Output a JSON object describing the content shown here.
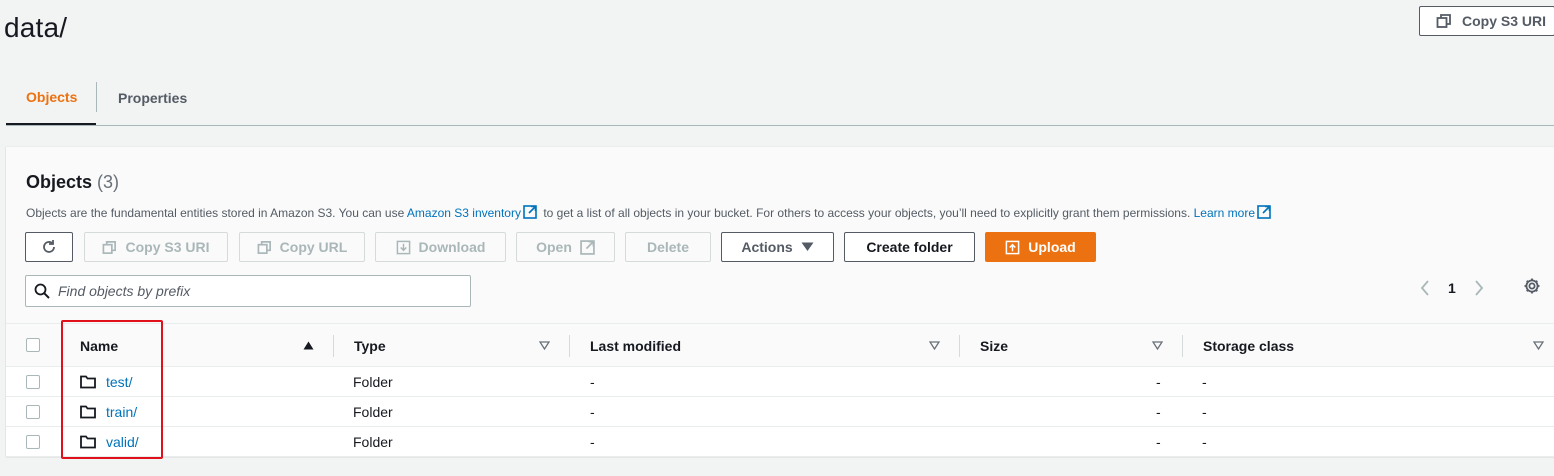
{
  "page": {
    "title": "data/",
    "copy_s3_uri_label": "Copy S3 URI"
  },
  "tabs": [
    {
      "label": "Objects"
    },
    {
      "label": "Properties"
    }
  ],
  "objects_panel": {
    "title": "Objects",
    "count": "(3)",
    "desc_prefix": "Objects are the fundamental entities stored in Amazon S3. You can use ",
    "desc_link1": "Amazon S3 inventory",
    "desc_middle": " to get a list of all objects in your bucket. For others to access your objects, you’ll need to explicitly grant them permissions. ",
    "desc_link2": "Learn more"
  },
  "toolbar": {
    "copy_s3_uri": "Copy S3 URI",
    "copy_url": "Copy URL",
    "download": "Download",
    "open": "Open",
    "delete": "Delete",
    "actions": "Actions",
    "create_folder": "Create folder",
    "upload": "Upload"
  },
  "search": {
    "placeholder": "Find objects by prefix"
  },
  "pagination": {
    "current_page": "1"
  },
  "table": {
    "columns": [
      "Name",
      "Type",
      "Last modified",
      "Size",
      "Storage class"
    ],
    "rows": [
      {
        "name": "test/",
        "type": "Folder",
        "last_modified": "-",
        "size": "-",
        "storage_class": "-"
      },
      {
        "name": "train/",
        "type": "Folder",
        "last_modified": "-",
        "size": "-",
        "storage_class": "-"
      },
      {
        "name": "valid/",
        "type": "Folder",
        "last_modified": "-",
        "size": "-",
        "storage_class": "-"
      }
    ]
  },
  "colors": {
    "accent": "#ec7211",
    "link": "#0073bb",
    "highlight": "#e0111a"
  },
  "icons": [
    "copy-icon",
    "refresh-icon",
    "download-icon",
    "external-link-icon",
    "caret-down-icon",
    "upload-icon",
    "search-icon",
    "chevron-left-icon",
    "chevron-right-icon",
    "gear-icon",
    "folder-icon",
    "sort-ascending-icon",
    "sort-icon"
  ]
}
